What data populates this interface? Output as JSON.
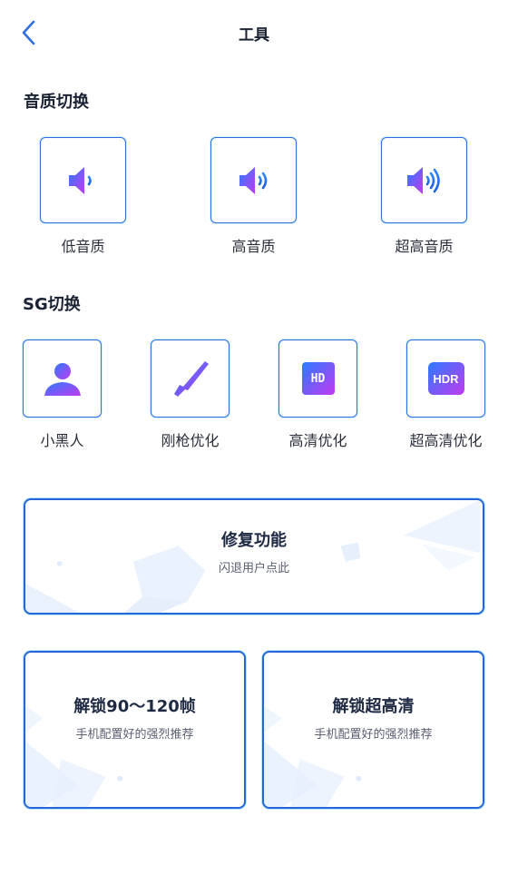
{
  "header": {
    "title": "工具",
    "back_icon": "chevron-left-icon"
  },
  "sound_section": {
    "title": "音质切换",
    "items": [
      {
        "label": "低音质",
        "icon": "speaker-low-icon"
      },
      {
        "label": "高音质",
        "icon": "speaker-medium-icon"
      },
      {
        "label": "超高音质",
        "icon": "speaker-high-icon"
      }
    ]
  },
  "sg_section": {
    "title": "SG切换",
    "items": [
      {
        "label": "小黑人",
        "icon": "person-icon"
      },
      {
        "label": "刚枪优化",
        "icon": "rifle-icon"
      },
      {
        "label": "高清优化",
        "icon": "hd-icon",
        "badge": "HD"
      },
      {
        "label": "超高清优化",
        "icon": "hdr-icon",
        "badge": "HDR"
      }
    ]
  },
  "repair_card": {
    "title": "修复功能",
    "subtitle": "闪退用户点此"
  },
  "unlock_fps_card": {
    "title": "解锁90～120帧",
    "subtitle": "手机配置好的强烈推荐"
  },
  "unlock_uhd_card": {
    "title": "解锁超高清",
    "subtitle": "手机配置好的强烈推荐"
  },
  "colors": {
    "accent": "#2766d8",
    "icon_gradient_start": "#2a7bff",
    "icon_gradient_end": "#c23af0"
  }
}
